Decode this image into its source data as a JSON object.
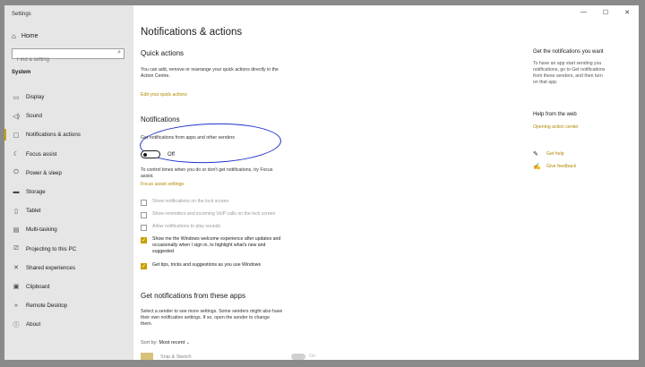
{
  "window": {
    "app_title": "Settings",
    "controls": [
      "—",
      "☐",
      "✕"
    ]
  },
  "sidebar": {
    "home_label": "Home",
    "search_placeholder": "Find a setting",
    "section_label": "System",
    "items": [
      {
        "label": "Display",
        "icon": "display-icon",
        "glyph": "▭"
      },
      {
        "label": "Sound",
        "icon": "sound-icon",
        "glyph": "◁)"
      },
      {
        "label": "Notifications & actions",
        "icon": "notifications-icon",
        "glyph": "▢"
      },
      {
        "label": "Focus assist",
        "icon": "focus-assist-icon",
        "glyph": "☾"
      },
      {
        "label": "Power & sleep",
        "icon": "power-icon",
        "glyph": "⏻"
      },
      {
        "label": "Storage",
        "icon": "storage-icon",
        "glyph": "▬"
      },
      {
        "label": "Tablet",
        "icon": "tablet-icon",
        "glyph": "▯"
      },
      {
        "label": "Multi-tasking",
        "icon": "multitasking-icon",
        "glyph": "▤"
      },
      {
        "label": "Projecting to this PC",
        "icon": "projecting-icon",
        "glyph": "⎚"
      },
      {
        "label": "Shared experiences",
        "icon": "shared-experiences-icon",
        "glyph": "✕"
      },
      {
        "label": "Clipboard",
        "icon": "clipboard-icon",
        "glyph": "▣"
      },
      {
        "label": "Remote Desktop",
        "icon": "remote-desktop-icon",
        "glyph": "»"
      },
      {
        "label": "About",
        "icon": "about-icon",
        "glyph": "ⓘ"
      }
    ],
    "active_index": 2
  },
  "main": {
    "title": "Notifications & actions",
    "quick_actions": {
      "heading": "Quick actions",
      "line1": "You can add, remove or rearrange your quick actions directly in the",
      "line2": "Action Centre.",
      "edit_link": "Edit your quick actions"
    },
    "notifications": {
      "heading": "Notifications",
      "toggle_label": "Get notifications from apps and other senders",
      "toggle_state": "Off",
      "info_line1": "To control times when you do or don't get notifications, try Focus",
      "info_line2": "assist.",
      "focus_link": "Focus assist settings",
      "options": [
        {
          "label": [
            "Show notifications on the lock screen"
          ],
          "checked": false,
          "disabled": true
        },
        {
          "label": [
            "Show reminders and incoming VoIP calls on the lock screen"
          ],
          "checked": false,
          "disabled": true
        },
        {
          "label": [
            "Allow notifications to play sounds"
          ],
          "checked": false,
          "disabled": true
        },
        {
          "label": [
            "Show me the Windows welcome experience after updates and",
            "occasionally when I sign in, to highlight what's new and",
            "suggested"
          ],
          "checked": true,
          "disabled": false
        },
        {
          "label": [
            "Get tips, tricks and suggestions as you use Windows"
          ],
          "checked": true,
          "disabled": false
        }
      ]
    },
    "senders": {
      "heading": "Get notifications from these apps",
      "line1": "Select a sender to see more settings. Some senders might also have",
      "line2": "their own notification settings. If so, open the sender to change",
      "line3": "them.",
      "sort_label": "Sort by:",
      "sort_value": "Most recent",
      "first_sender": "Snip & Sketch",
      "first_sender_state": "On"
    }
  },
  "right_pane": {
    "heading1": "Get the notifications you want",
    "text1": [
      "To have an app start sending you",
      "notifications, go to Get notifications",
      "from these senders, and then turn",
      "on that app."
    ],
    "heading2": "Help from the web",
    "link_opening": "Opening action center",
    "get_help": "Get help",
    "give_feedback": "Give feedback"
  },
  "colors": {
    "accent": "#c8a000",
    "link": "#b08900",
    "annotation": "#2233cc",
    "sidebar_bg": "#e6e6e6"
  }
}
